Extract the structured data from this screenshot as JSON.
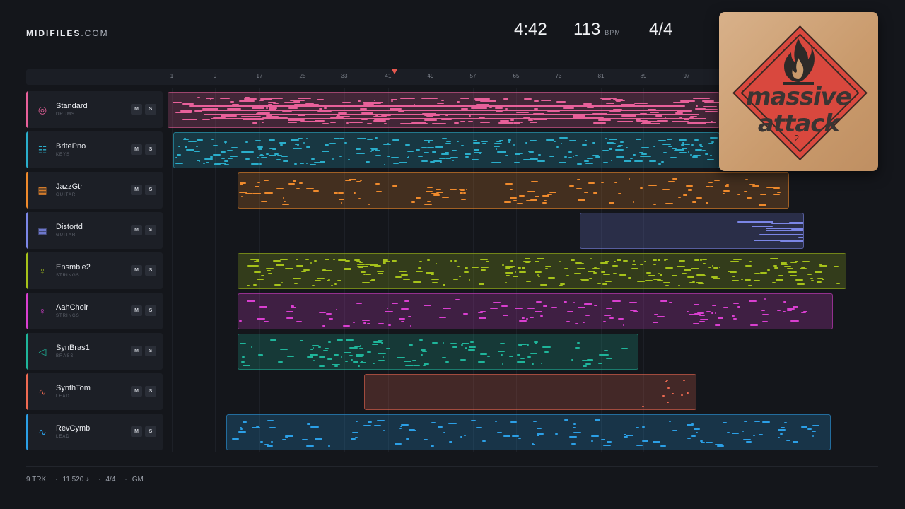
{
  "header": {
    "logo_bold": "MIDIFILES",
    "logo_light": ".COM",
    "duration": "4:42",
    "tempo": "113",
    "tempo_unit": "BPM",
    "time_signature": "4/4"
  },
  "ruler": {
    "bars": [
      "1",
      "9",
      "17",
      "25",
      "33",
      "41",
      "49",
      "57",
      "65",
      "73",
      "81",
      "89",
      "97"
    ]
  },
  "tracks": [
    {
      "name": "Standard",
      "category": "DRUMS",
      "icon": "drum-icon",
      "color": "#e8609a",
      "mute": "M",
      "solo": "S"
    },
    {
      "name": "BritePno",
      "category": "KEYS",
      "icon": "piano-icon",
      "color": "#2aaecb",
      "mute": "M",
      "solo": "S"
    },
    {
      "name": "JazzGtr",
      "category": "GUITAR",
      "icon": "guitar-fretboard-icon",
      "color": "#ef8a2c",
      "mute": "M",
      "solo": "S"
    },
    {
      "name": "Distortd",
      "category": "GUITAR",
      "icon": "guitar-fretboard-icon",
      "color": "#7b86e6",
      "mute": "M",
      "solo": "S"
    },
    {
      "name": "Ensmble2",
      "category": "STRINGS",
      "icon": "violin-icon",
      "color": "#a6c21a",
      "mute": "M",
      "solo": "S"
    },
    {
      "name": "AahChoir",
      "category": "STRINGS",
      "icon": "violin-icon",
      "color": "#d93fd0",
      "mute": "M",
      "solo": "S"
    },
    {
      "name": "SynBras1",
      "category": "BRASS",
      "icon": "horn-icon",
      "color": "#1fb59a",
      "mute": "M",
      "solo": "S"
    },
    {
      "name": "SynthTom",
      "category": "LEAD",
      "icon": "waveform-icon",
      "color": "#ef6a52",
      "mute": "M",
      "solo": "S"
    },
    {
      "name": "RevCymbl",
      "category": "LEAD",
      "icon": "waveform-icon",
      "color": "#2b9fe6",
      "mute": "M",
      "solo": "S"
    }
  ],
  "footer": {
    "tracks": "9 TRK",
    "notes": "11 520 ♪",
    "meter": "4/4",
    "standard": "GM"
  },
  "album_cover": {
    "artist": "massive attack",
    "line1": "massive",
    "line2": "attack",
    "number": "2",
    "icon": "flame-icon"
  },
  "colors": {
    "background": "#14161b",
    "playhead": "#e5584f"
  }
}
